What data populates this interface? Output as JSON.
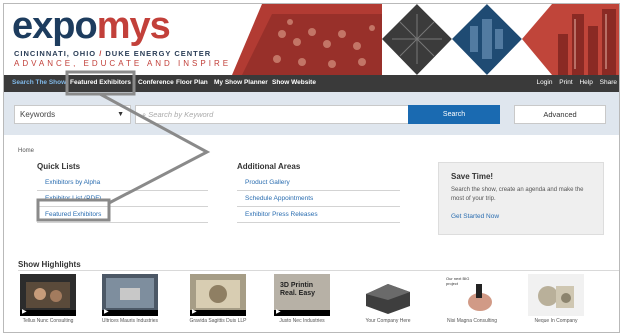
{
  "header": {
    "logo_part1": "expo",
    "logo_part2": "mys",
    "city": "CINCINNATI, OHIO",
    "separator": "/",
    "venue": "DUKE ENERGY CENTER",
    "tagline": "ADVANCE, EDUCATE AND INSPIRE"
  },
  "nav": {
    "items": [
      "Search The Show",
      "Featured Exhibitors",
      "Conference",
      "Floor Plan",
      "My Show Planner",
      "Show Website"
    ],
    "right": [
      "Login",
      "Print",
      "Help",
      "Share"
    ]
  },
  "search": {
    "scope": "Keywords",
    "placeholder": "Search by Keyword",
    "button": "Search",
    "advanced": "Advanced"
  },
  "breadcrumb": "Home",
  "quick_lists": {
    "title": "Quick Lists",
    "items": [
      "Exhibitors by Alpha",
      "Exhibitor List (PDF)",
      "Featured Exhibitors"
    ]
  },
  "additional_areas": {
    "title": "Additional Areas",
    "items": [
      "Product Gallery",
      "Schedule Appointments",
      "Exhibitor Press Releases"
    ]
  },
  "save_time": {
    "title": "Save Time!",
    "description": "Search the show, create an agenda and make the most of your trip.",
    "link": "Get Started Now"
  },
  "highlights": {
    "title": "Show Highlights",
    "items": [
      {
        "caption": "Tellus Nunc Consulting",
        "img_label": ""
      },
      {
        "caption": "Ultrices Mauris Industries",
        "img_label": ""
      },
      {
        "caption": "Gravida Sagittis Duis LLP",
        "img_label": ""
      },
      {
        "caption": "Justo Nec Industries",
        "img_label": "3D Printin Real. Easy"
      },
      {
        "caption": "Your Company Here",
        "img_label": ""
      },
      {
        "caption": "Nisi Magna Consulting",
        "img_label": "Our next BIG project"
      },
      {
        "caption": "Neque In Company",
        "img_label": ""
      }
    ]
  },
  "colors": {
    "brand_navy": "#1d3c5e",
    "brand_red": "#c2403a",
    "nav_bg": "#3a3a3a",
    "link": "#2a6db0",
    "button": "#1a6ab1",
    "annotation": "#8a8a8a"
  }
}
